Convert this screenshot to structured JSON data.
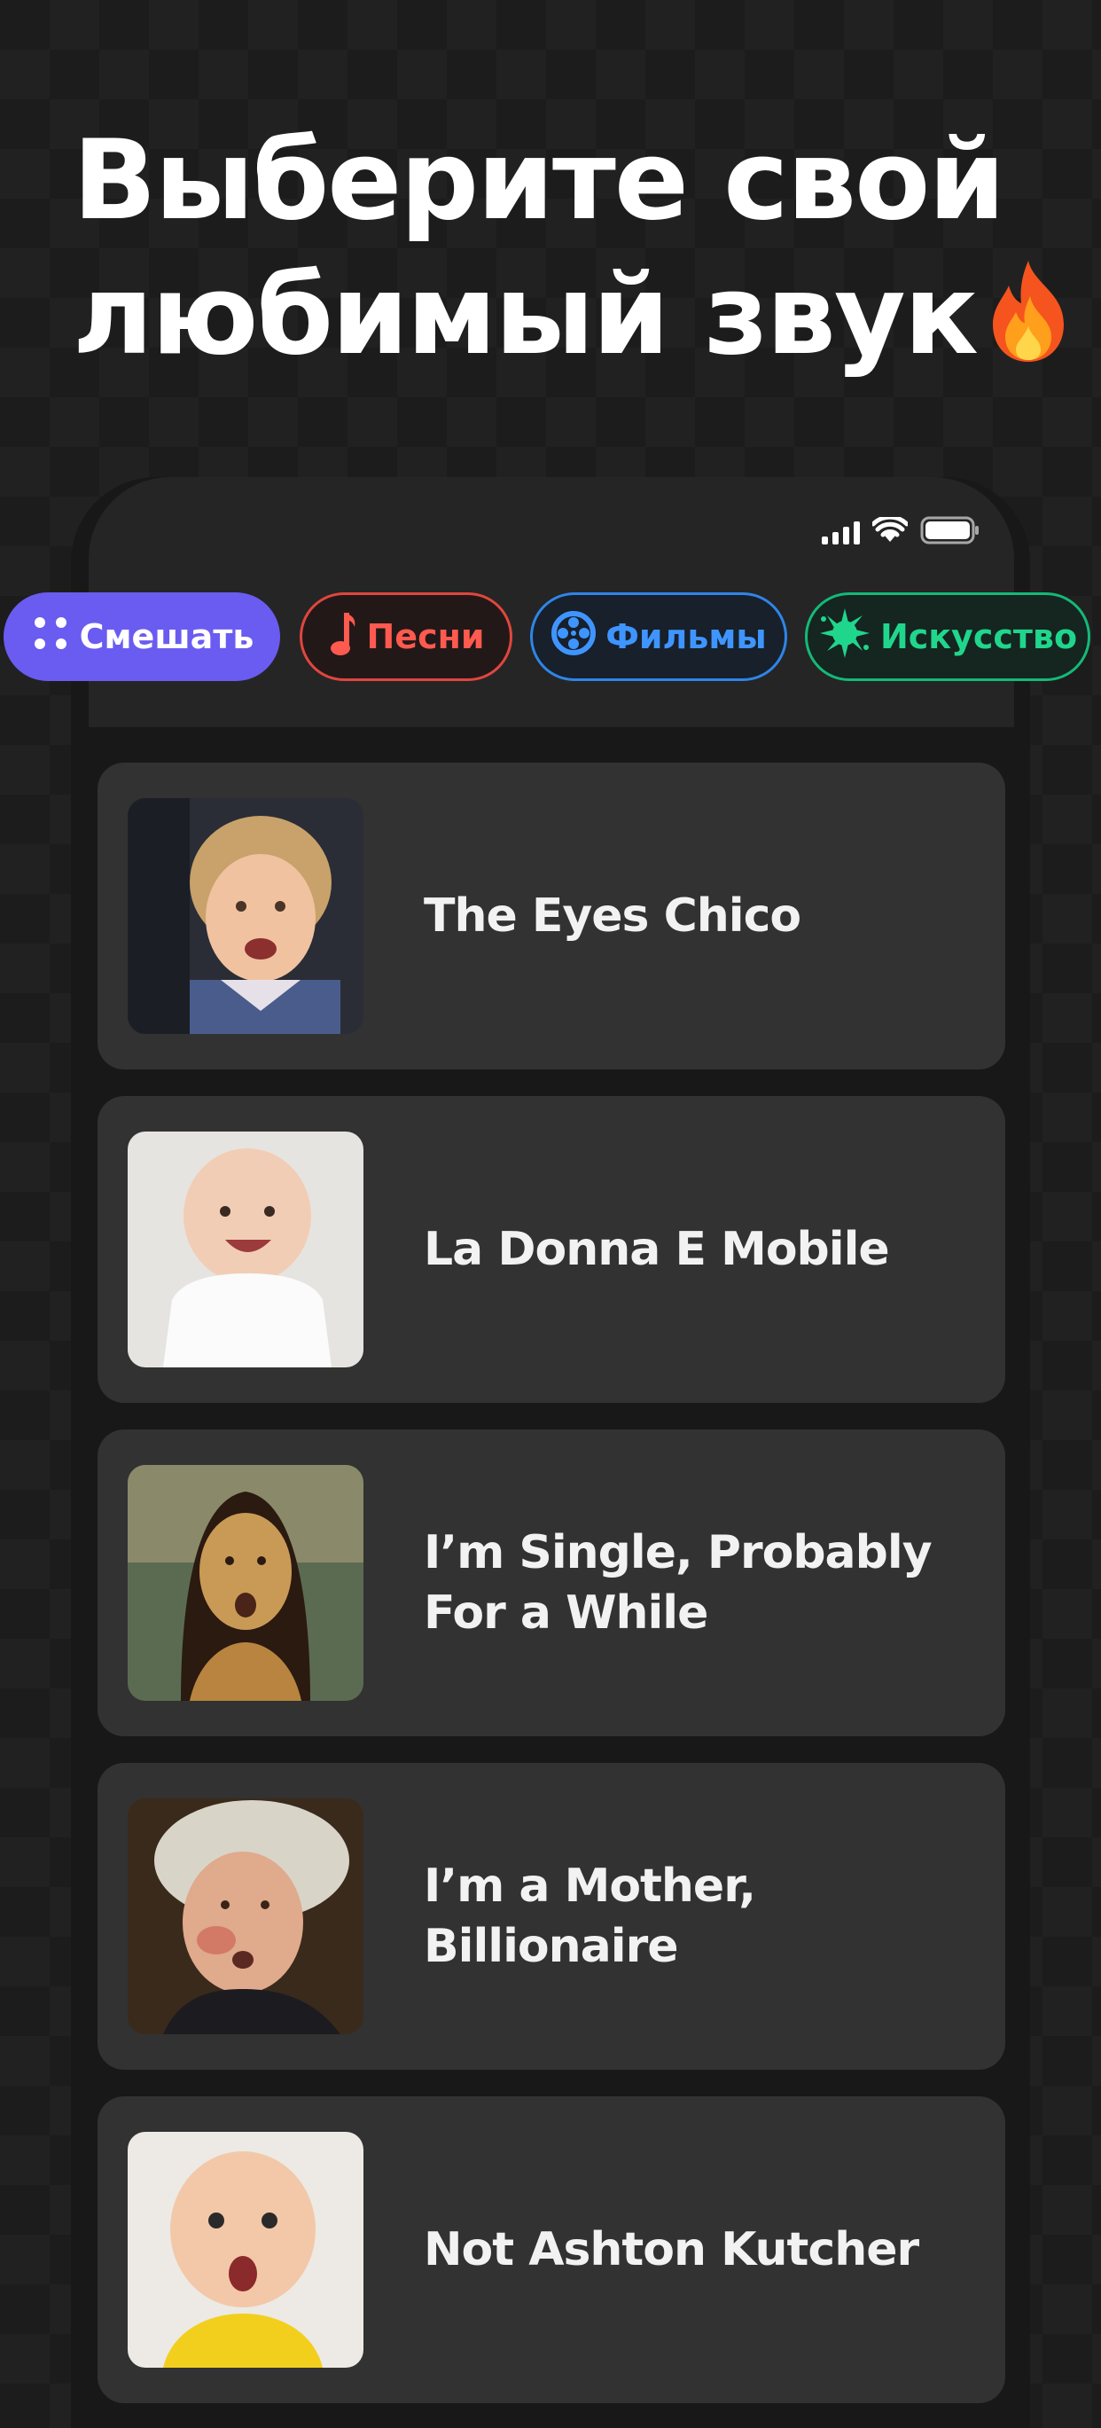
{
  "headline": {
    "line1": "Выберите свой",
    "line2": "любимый звук"
  },
  "categories": [
    {
      "label": "Смешать",
      "icon": "dots-icon",
      "color": "#6a5cf0"
    },
    {
      "label": "Песни",
      "icon": "music-note-icon",
      "color": "#ff5a4f"
    },
    {
      "label": "Фильмы",
      "icon": "film-reel-icon",
      "color": "#3f95ff"
    },
    {
      "label": "Искусство",
      "icon": "paint-splash-icon",
      "color": "#20d68c"
    }
  ],
  "sounds": [
    {
      "title": "The Eyes Chico"
    },
    {
      "title": "La Donna E Mobile"
    },
    {
      "title": "I’m Single, Probably For a While"
    },
    {
      "title": "I’m a Mother, Billionaire"
    },
    {
      "title": "Not Ashton Kutcher"
    }
  ]
}
